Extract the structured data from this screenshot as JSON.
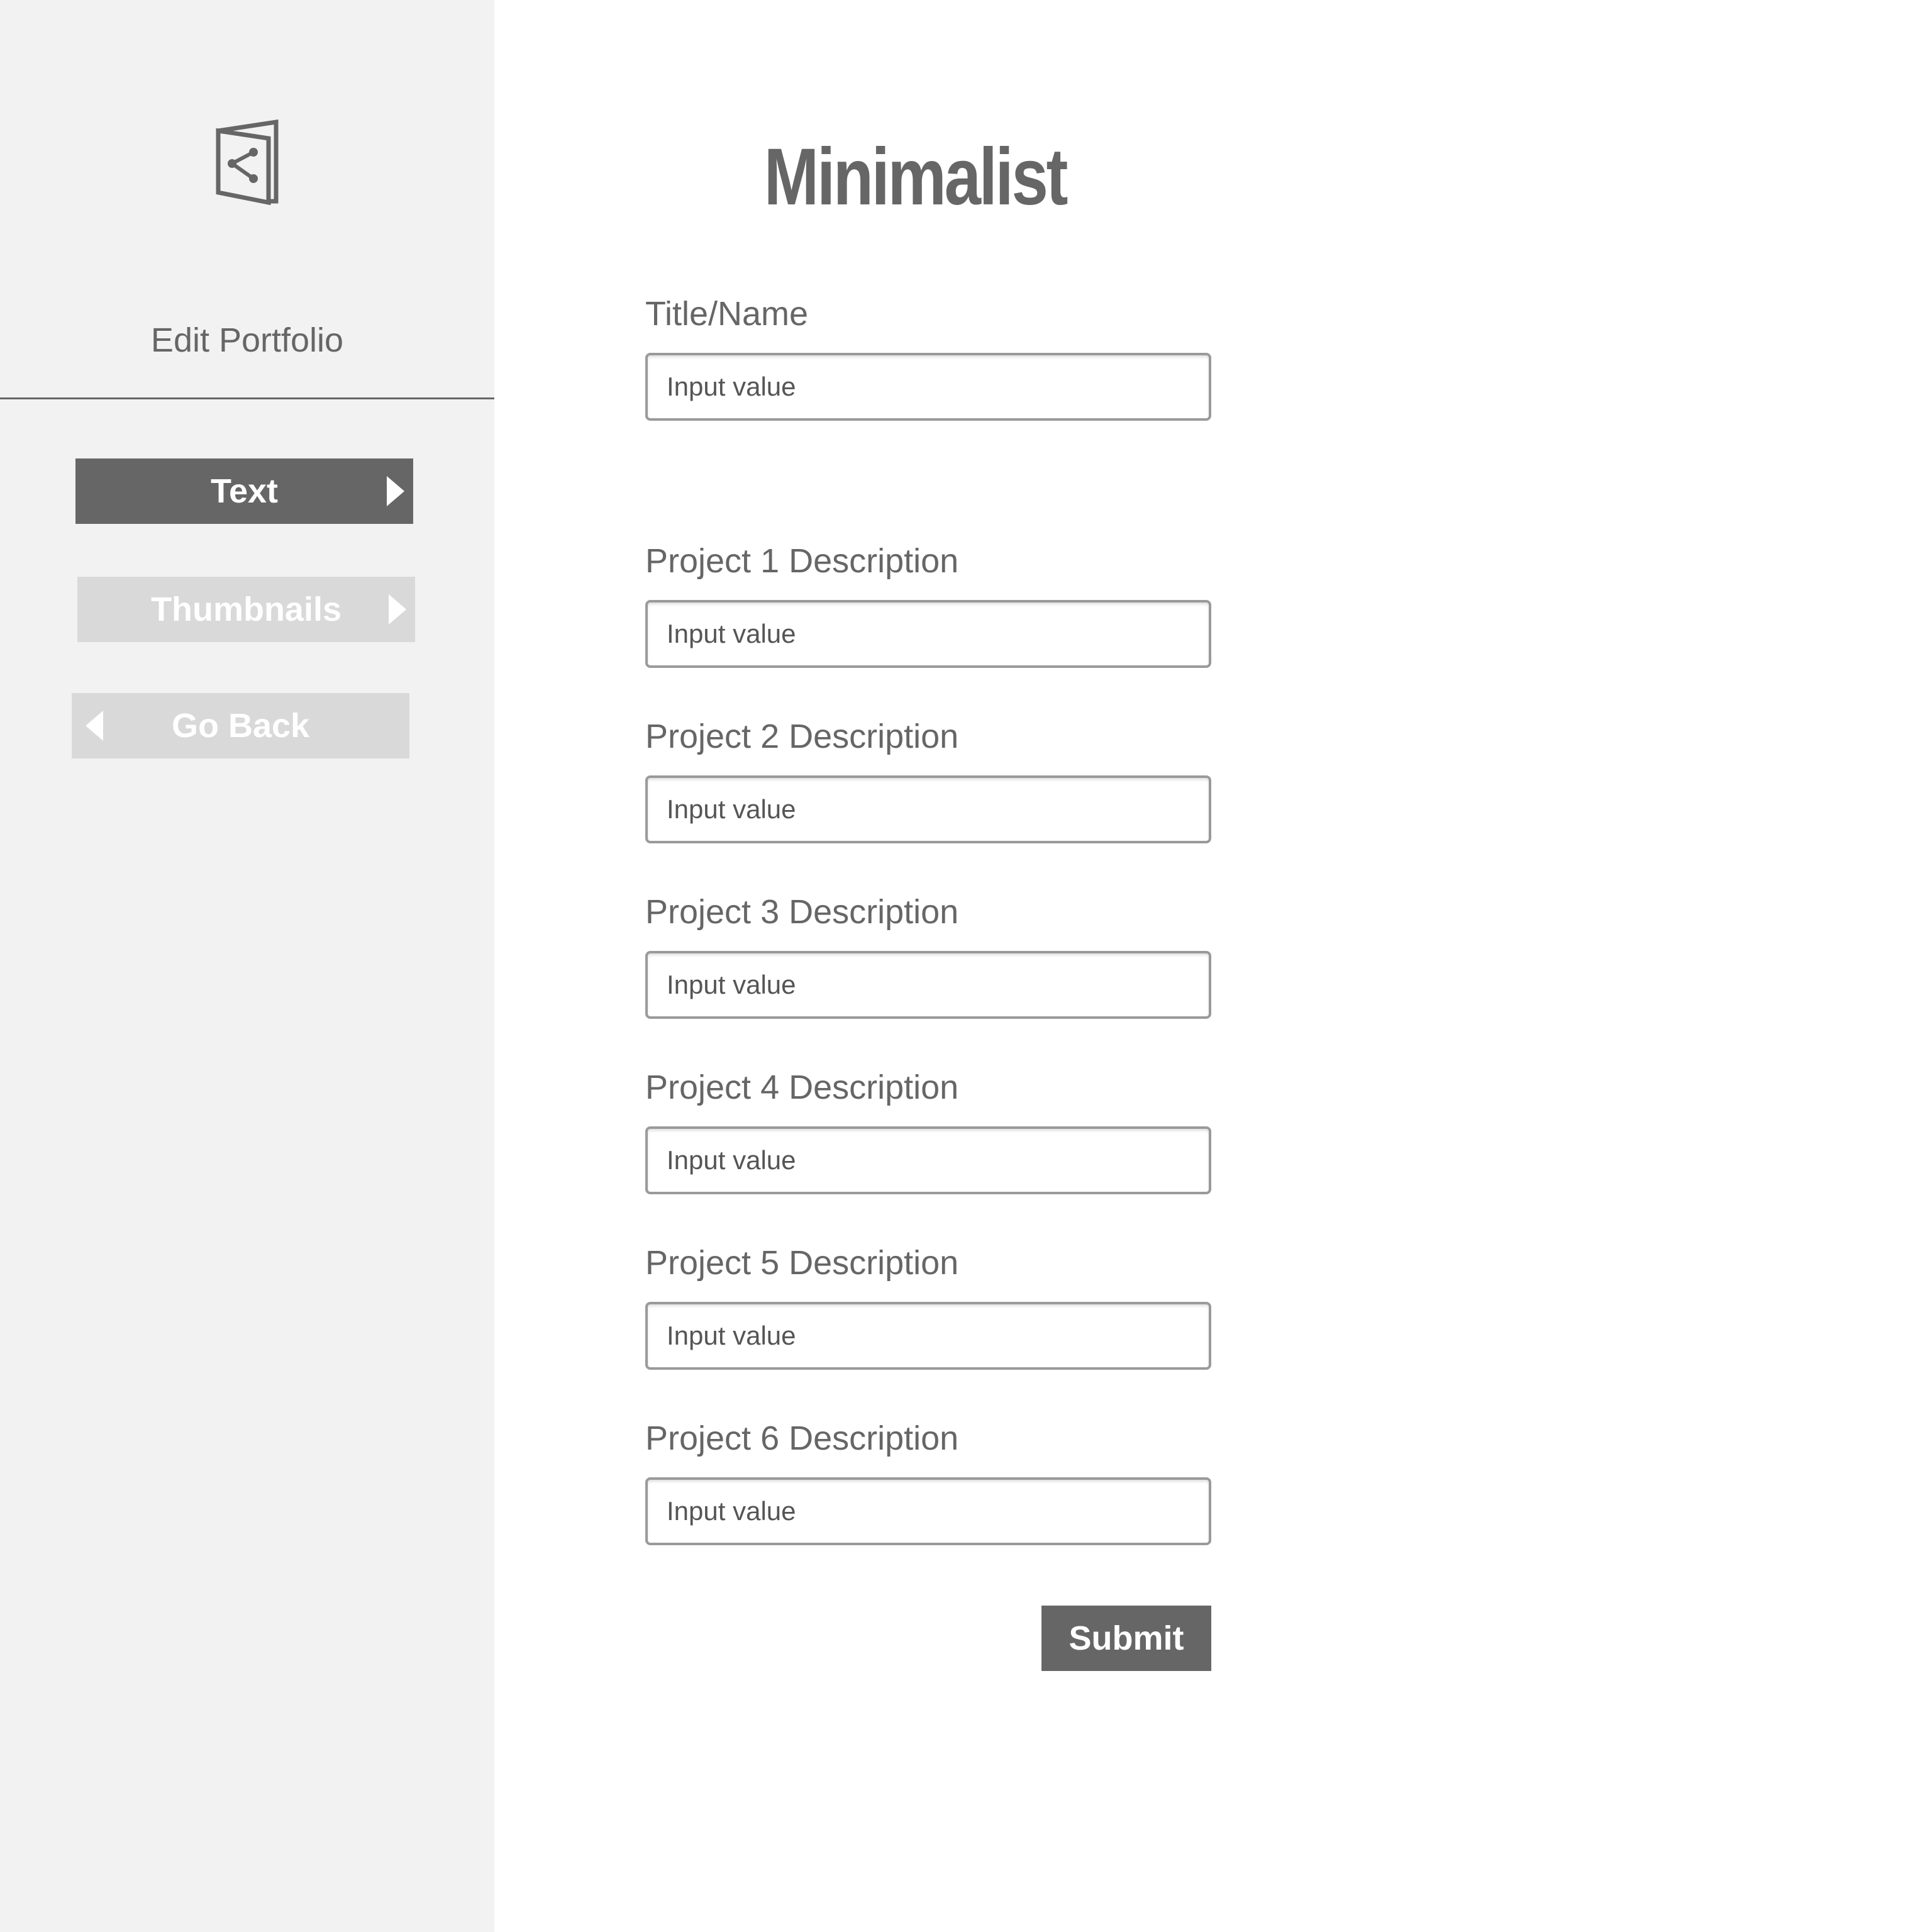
{
  "sidebar": {
    "logo_icon": "portfolio-share-icon",
    "title": "Edit Portfolio",
    "nav": {
      "text_label": "Text",
      "thumbnails_label": "Thumbnails",
      "go_back_label": "Go Back"
    }
  },
  "main": {
    "title": "Minimalist",
    "fields": [
      {
        "label": "Title/Name",
        "value": "Input value"
      },
      {
        "label": "Project 1 Description",
        "value": "Input value"
      },
      {
        "label": "Project 2 Description",
        "value": "Input value"
      },
      {
        "label": "Project 3 Description",
        "value": "Input value"
      },
      {
        "label": "Project 4 Description",
        "value": "Input value"
      },
      {
        "label": "Project 5 Description",
        "value": "Input value"
      },
      {
        "label": "Project 6 Description",
        "value": "Input value"
      }
    ],
    "submit_label": "Submit"
  },
  "colors": {
    "sidebar_bg": "#f2f2f2",
    "active_button": "#666666",
    "inactive_button": "#d9d9d9",
    "text": "#666666"
  }
}
